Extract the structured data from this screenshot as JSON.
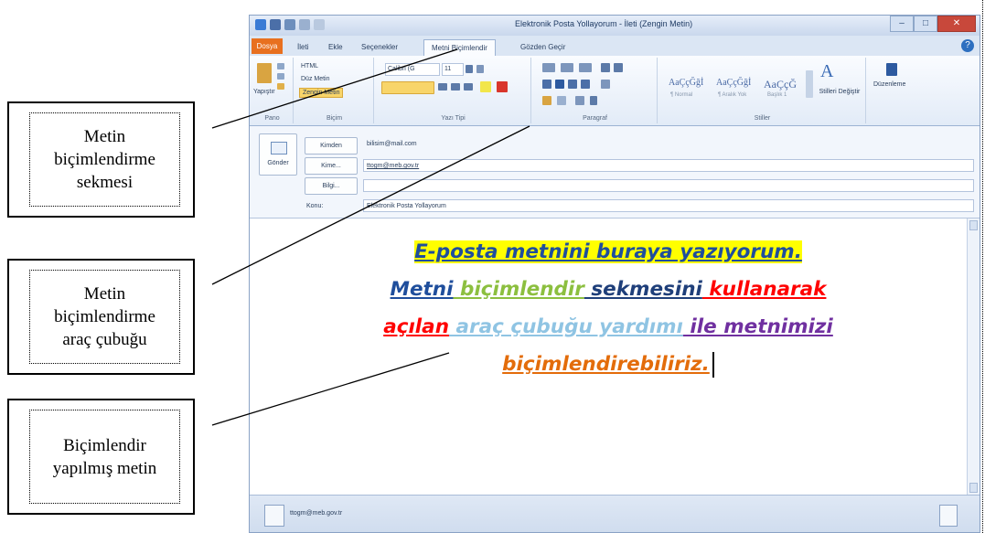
{
  "callouts": [
    {
      "lines": [
        "Metin",
        "biçimlendirme",
        "sekmesi"
      ]
    },
    {
      "lines": [
        "Metin",
        "biçimlendirme",
        "araç çubuğu"
      ]
    },
    {
      "lines": [
        "Biçimlendir",
        "yapılmış metin"
      ]
    }
  ],
  "window": {
    "title": "Elektronik Posta Yollayorum - İleti (Zengin Metin)",
    "controls": {
      "minimize": "–",
      "maximize": "□",
      "close": "✕"
    }
  },
  "tabs": {
    "file": "Dosya",
    "items": [
      "İleti",
      "Ekle",
      "Seçenekler",
      "Metni Biçimlendir",
      "Gözden Geçir"
    ],
    "active_index": 3,
    "help": "?"
  },
  "ribbon": {
    "clipboard": {
      "paste": "Yapıştır",
      "label": "Pano"
    },
    "format": {
      "html": "HTML",
      "plain": "Düz Metin",
      "rich": "Zengin Metin",
      "label": "Biçim"
    },
    "font": {
      "name": "Calibri (G",
      "size": "11",
      "label": "Yazı Tipi"
    },
    "paragraph": {
      "label": "Paragraf"
    },
    "styles": {
      "samples": [
        {
          "sample": "AaÇçĞğİ",
          "name": "¶ Normal"
        },
        {
          "sample": "AaÇçĞğİ",
          "name": "¶ Aralık Yok"
        },
        {
          "sample": "AaÇçĞ",
          "name": "Başlık 1"
        }
      ],
      "change": "Stilleri Değiştir",
      "label": "Stiller"
    },
    "editing": {
      "label": "Düzenleme"
    }
  },
  "compose": {
    "send": "Gönder",
    "from_button": "Kimden",
    "from_value": "bilisim@mail.com",
    "to_button": "Kime...",
    "to_value": "ttogm@meb.gov.tr",
    "cc_button": "Bilgi...",
    "cc_value": "",
    "subject_label": "Konu:",
    "subject_value": "Elektronik Posta Yollayorum"
  },
  "body": {
    "line1": "E-posta metnini buraya yazıyorum.",
    "line2": [
      {
        "text": "Metni",
        "color": "#1f4e9c"
      },
      {
        "text": " biçimlendir",
        "color": "#8cbf3f"
      },
      {
        "text": " sekmesini",
        "color": "#1f3f7a"
      },
      {
        "text": " kullanarak",
        "color": "#ff0000"
      }
    ],
    "line3": [
      {
        "text": "açılan",
        "color": "#ff0000"
      },
      {
        "text": " araç çubuğu yardımı",
        "color": "#8fc4e3"
      },
      {
        "text": " ile metnimizi",
        "color": "#7030a0"
      }
    ],
    "line4": {
      "text": "biçimlendirebiliriz.",
      "color": "#e36c0a"
    },
    "line1_color": "#1f4e9c",
    "highlight": "#ffff00"
  },
  "status": {
    "person": "ttogm@meb.gov.tr"
  }
}
